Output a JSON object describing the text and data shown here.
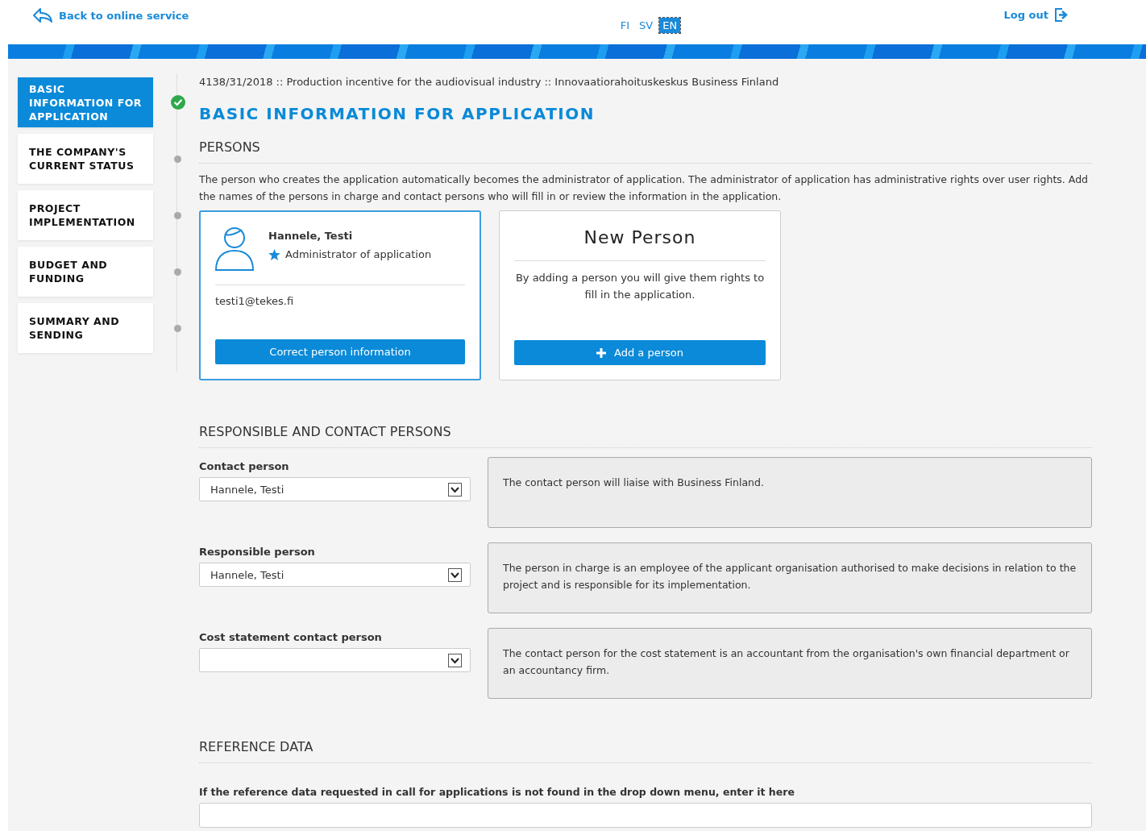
{
  "header": {
    "back_link": "Back to online service",
    "languages": [
      {
        "label": "FI",
        "selected": false
      },
      {
        "label": "SV",
        "selected": false
      },
      {
        "label": "EN",
        "selected": true
      }
    ],
    "logout": "Log out"
  },
  "steps": [
    {
      "label": "BASIC INFORMATION FOR APPLICATION",
      "selected": true,
      "completed": true
    },
    {
      "label": "THE COMPANY'S CURRENT STATUS",
      "selected": false,
      "completed": false
    },
    {
      "label": "PROJECT IMPLEMENTATION",
      "selected": false,
      "completed": false
    },
    {
      "label": "BUDGET AND FUNDING",
      "selected": false,
      "completed": false
    },
    {
      "label": "SUMMARY AND SENDING",
      "selected": false,
      "completed": false
    }
  ],
  "breadcrumb": "4138/31/2018 :: Production incentive for the audiovisual industry :: Innovaatiorahoituskeskus Business Finland",
  "page_title": "BASIC INFORMATION FOR APPLICATION",
  "persons": {
    "heading": "PERSONS",
    "intro": "The person who creates the application automatically becomes the administrator of application. The administrator of application has administrative rights over user rights. Add the names of the persons in charge and contact persons who will fill in or review the information in the application.",
    "person_card": {
      "name": "Hannele, Testi",
      "role": "Administrator of application",
      "email": "testi1@tekes.fi",
      "button": "Correct person information"
    },
    "new_card": {
      "title": "New Person",
      "text": "By adding a person you will give them rights to fill in the application.",
      "button": "Add a person"
    }
  },
  "contacts": {
    "heading": "RESPONSIBLE AND CONTACT PERSONS",
    "rows": [
      {
        "label": "Contact person",
        "value": "Hannele, Testi",
        "help": "The contact person will liaise with Business Finland."
      },
      {
        "label": "Responsible person",
        "value": "Hannele, Testi",
        "help": "The person in charge is an employee of the applicant organisation authorised to make decisions in relation to the project and is responsible for its implementation."
      },
      {
        "label": "Cost statement contact person",
        "help": "The contact person for the cost statement is an accountant from the organisation's own financial department or an accountancy firm."
      }
    ]
  },
  "reference": {
    "heading": "REFERENCE DATA",
    "label": "If the reference data requested in call for applications is not found in the drop down menu, enter it here"
  }
}
